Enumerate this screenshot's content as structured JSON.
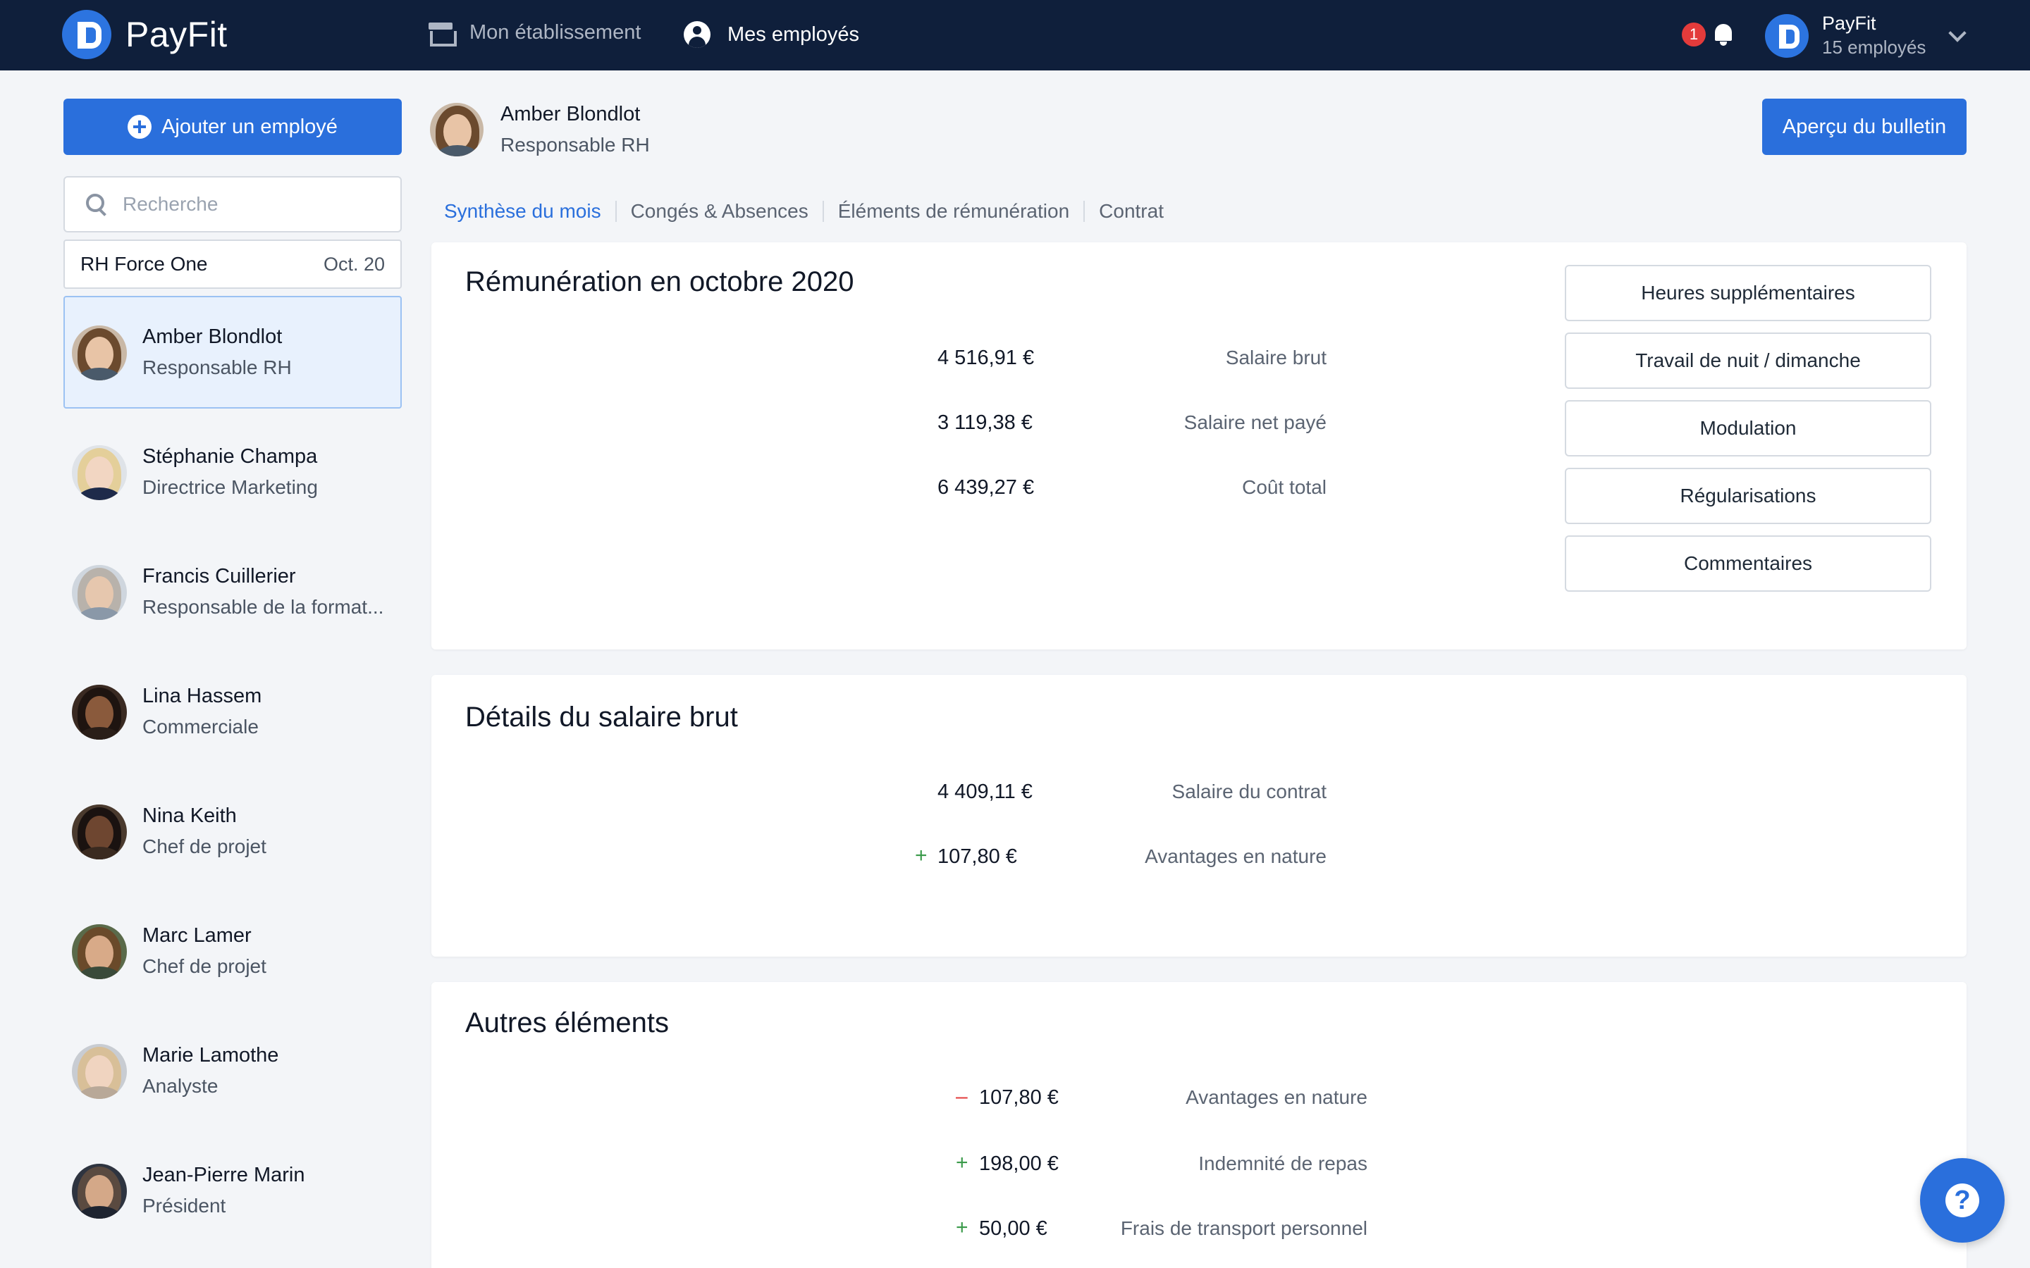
{
  "app": {
    "name": "PayFit",
    "nav": [
      {
        "label": "Mon établissement",
        "icon": "store-icon"
      },
      {
        "label": "Mes employés",
        "icon": "user-circle-icon"
      }
    ],
    "notifications": "1",
    "company": {
      "name": "PayFit",
      "count": "15 employés"
    }
  },
  "sidebar": {
    "add_button": "Ajouter un employé",
    "search_placeholder": "Recherche",
    "period": {
      "name": "RH Force One",
      "date": "Oct. 20"
    },
    "employees": [
      {
        "name": "Amber Blondlot",
        "role": "Responsable RH"
      },
      {
        "name": "Stéphanie Champa",
        "role": "Directrice Marketing"
      },
      {
        "name": "Francis Cuillerier",
        "role": "Responsable de la format..."
      },
      {
        "name": "Lina Hassem",
        "role": "Commerciale"
      },
      {
        "name": "Nina Keith",
        "role": "Chef de projet"
      },
      {
        "name": "Marc Lamer",
        "role": "Chef de projet"
      },
      {
        "name": "Marie Lamothe",
        "role": "Analyste"
      },
      {
        "name": "Jean-Pierre Marin",
        "role": "Président"
      }
    ]
  },
  "employee": {
    "name": "Amber Blondlot",
    "role": "Responsable RH",
    "preview_button": "Aperçu du bulletin"
  },
  "tabs": [
    "Synthèse du mois",
    "Congés & Absences",
    "Éléments de rémunération",
    "Contrat"
  ],
  "remuneration": {
    "title": "Rémunération en octobre 2020",
    "rows": [
      {
        "label": "Salaire brut",
        "value": "4 516,91 €"
      },
      {
        "label": "Salaire net payé",
        "value": "3 119,38 €"
      },
      {
        "label": "Coût total",
        "value": "6 439,27 €"
      }
    ],
    "buttons": [
      "Heures supplémentaires",
      "Travail de nuit / dimanche",
      "Modulation",
      "Régularisations",
      "Commentaires"
    ]
  },
  "gross_details": {
    "title": "Détails du salaire brut",
    "rows": [
      {
        "label": "Salaire du contrat",
        "sign": "",
        "value": "4 409,11 €"
      },
      {
        "label": "Avantages en nature",
        "sign": "+",
        "value": "107,80 €"
      }
    ]
  },
  "other": {
    "title": "Autres éléments",
    "rows": [
      {
        "label": "Avantages en nature",
        "sign": "–",
        "value": "107,80 €"
      },
      {
        "label": "Indemnité de repas",
        "sign": "+",
        "value": "198,00 €"
      },
      {
        "label": "Frais de transport personnel",
        "sign": "+",
        "value": "50,00 €"
      }
    ]
  },
  "help": {
    "icon": "?"
  }
}
